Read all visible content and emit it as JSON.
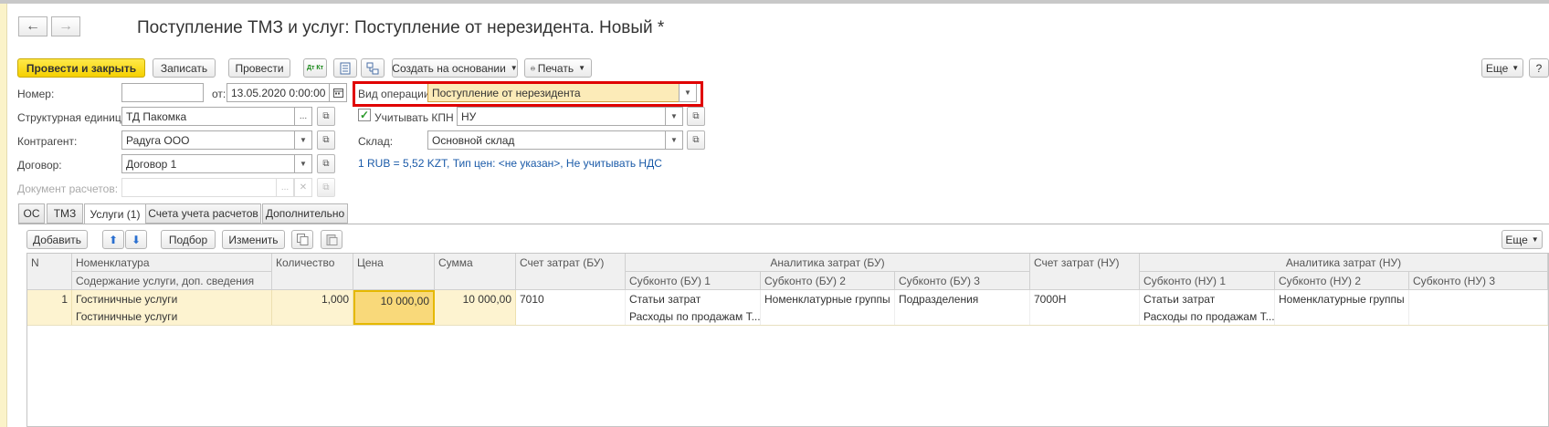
{
  "window": {
    "title": "Поступление ТМЗ и услуг: Поступление от нерезидента. Новый *",
    "back_icon": "←",
    "forward_icon": "→"
  },
  "toolbar": {
    "post_close": "Провести и закрыть",
    "save": "Записать",
    "post": "Провести",
    "dtkt_icon": "Дт Кт",
    "create_based_on": "Создать на основании",
    "print": "Печать",
    "more": "Еще",
    "help": "?"
  },
  "form": {
    "number_label": "Номер:",
    "number_value": "",
    "from_label": "от:",
    "date_value": "13.05.2020  0:00:00",
    "op_type_label": "Вид операции:",
    "op_type_value": "Поступление от нерезидента",
    "struct_unit_label": "Структурная единица:",
    "struct_unit_value": "ТД Пакомка",
    "kpn_label": "Учитывать КПН",
    "kpn_value": "НУ",
    "counterparty_label": "Контрагент:",
    "counterparty_value": "Радуга ООО",
    "warehouse_label": "Склад:",
    "warehouse_value": "Основной склад",
    "contract_label": "Договор:",
    "contract_value": "Договор 1",
    "rate_link": "1 RUB = 5,52 KZT, Тип цен: <не указан>, Не учитывать НДС",
    "settlement_doc_label": "Документ расчетов:",
    "settlement_doc_value": ""
  },
  "tabs": [
    {
      "label": "ОС"
    },
    {
      "label": "ТМЗ"
    },
    {
      "label": "Услуги (1)"
    },
    {
      "label": "Счета учета расчетов"
    },
    {
      "label": "Дополнительно"
    }
  ],
  "tab_toolbar": {
    "add": "Добавить",
    "select": "Подбор",
    "change": "Изменить",
    "more": "Еще"
  },
  "table": {
    "headers": {
      "n": "N",
      "nomenclature": "Номенклатура",
      "content": "Содержание услуги, доп. сведения",
      "quantity": "Количество",
      "price": "Цена",
      "sum": "Сумма",
      "cost_account_bu": "Счет затрат (БУ)",
      "analytics_bu": "Аналитика затрат (БУ)",
      "subconto_bu_1": "Субконто (БУ) 1",
      "subconto_bu_2": "Субконто (БУ) 2",
      "subconto_bu_3": "Субконто (БУ) 3",
      "cost_account_nu": "Счет затрат (НУ)",
      "analytics_nu": "Аналитика затрат (НУ)",
      "subconto_nu_1": "Субконто (НУ) 1",
      "subconto_nu_2": "Субконто (НУ) 2",
      "subconto_nu_3": "Субконто (НУ) 3"
    },
    "rows": [
      {
        "n": "1",
        "nomenclature": "Гостиничные услуги",
        "content": "Гостиничные услуги",
        "quantity": "1,000",
        "price": "10 000,00",
        "sum": "10 000,00",
        "cost_account_bu": "7010",
        "subconto_bu_1": "Статьи затрат",
        "subconto_bu_1_value": "Расходы по продажам Т...",
        "subconto_bu_2": "Номенклатурные группы",
        "subconto_bu_3": "Подразделения",
        "cost_account_nu": "7000Н",
        "subconto_nu_1": "Статьи затрат",
        "subconto_nu_1_value": "Расходы по продажам Т...",
        "subconto_nu_2": "Номенклатурные группы",
        "subconto_nu_3": ""
      }
    ]
  }
}
